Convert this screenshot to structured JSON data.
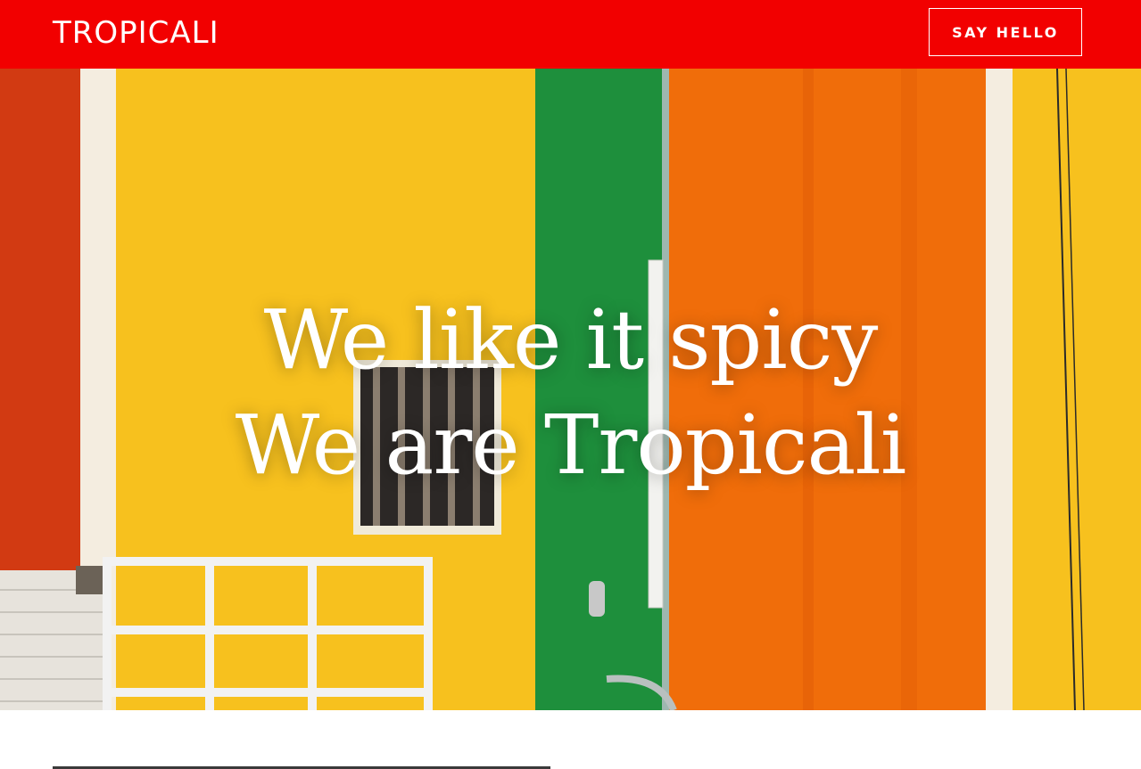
{
  "header": {
    "logo_text": "TROPICALI",
    "cta_label": "SAY HELLO"
  },
  "hero": {
    "line1": "We like it spicy",
    "line2": "We are Tropicali"
  },
  "colors": {
    "brand_red": "#f20000",
    "wall_yellow": "#f7c11e",
    "wall_orange": "#f06d0a",
    "wall_green": "#1e8f3c",
    "wall_red": "#d23a12"
  }
}
